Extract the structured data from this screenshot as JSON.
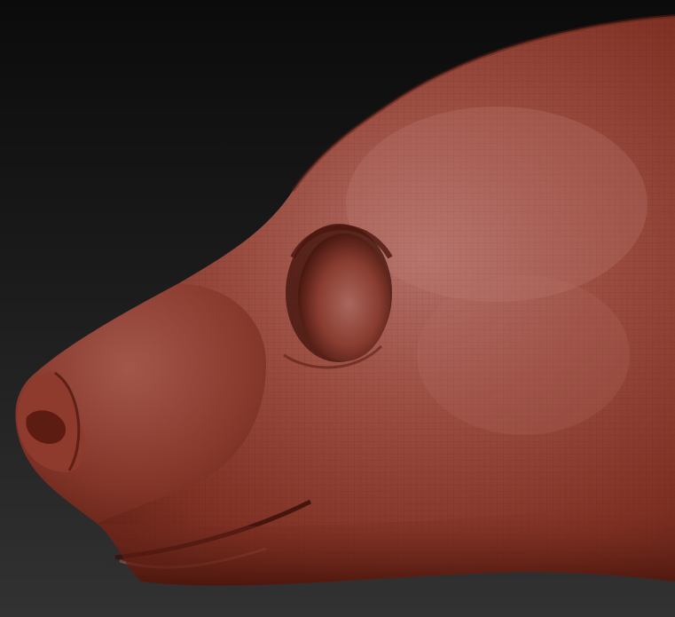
{
  "scene": {
    "subject": "sculpted-animal-head",
    "colors": {
      "background_top": "#0b0b0b",
      "background_bottom": "#323232",
      "clay_base": "#8d3a2c",
      "clay_light": "#b06a60",
      "clay_dark": "#5a1d13",
      "clay_shadow": "#3b1009"
    }
  }
}
